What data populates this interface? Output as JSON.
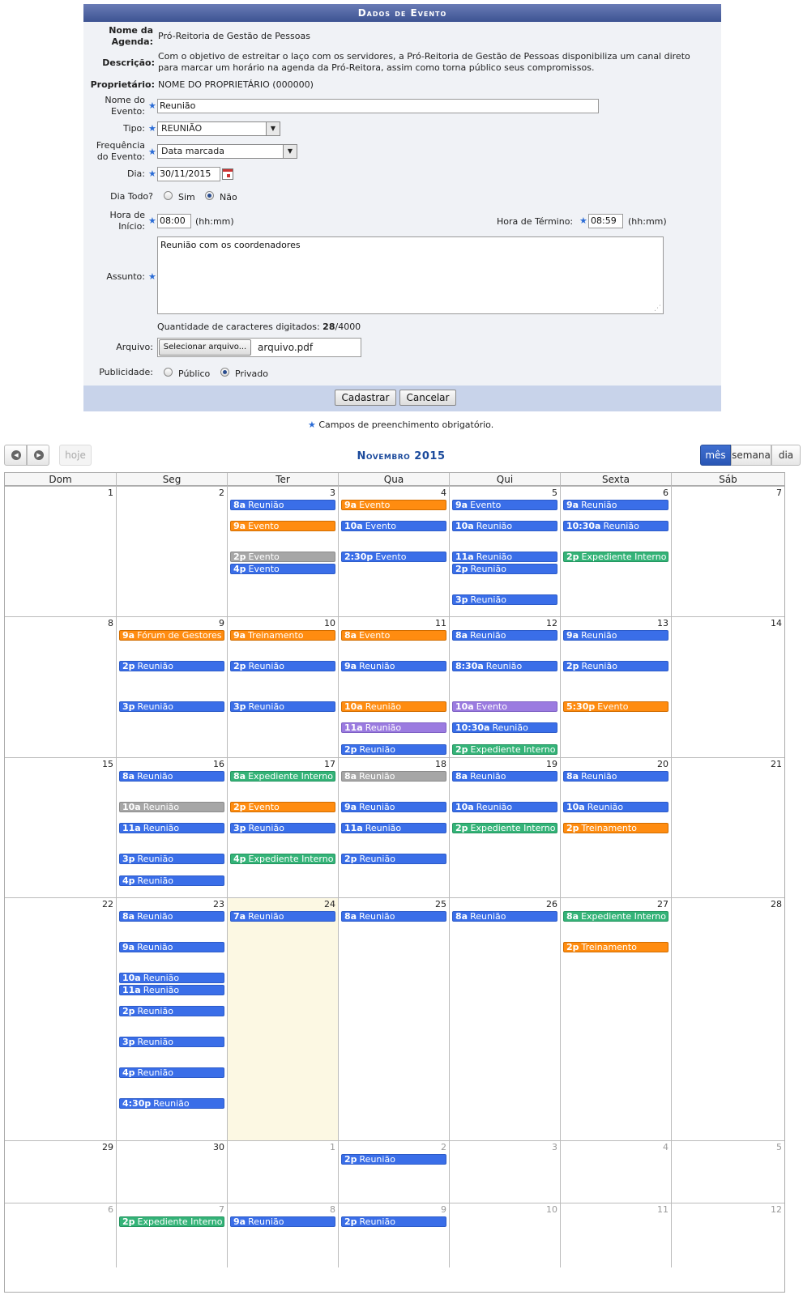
{
  "form": {
    "title": "Dados de Evento",
    "agenda_label": "Nome da Agenda:",
    "agenda_value": "Pró-Reitoria de Gestão de Pessoas",
    "descricao_label": "Descrição:",
    "descricao_line1": "Com o objetivo de estreitar o laço com os servidores, a Pró-Reitoria de Gestão de Pessoas disponibiliza um canal direto",
    "descricao_line2": "para marcar um horário na agenda da Pró-Reitora, assim como torna público seus compromissos.",
    "proprietario_label": "Proprietário:",
    "proprietario_value": "NOME DO PROPRIETÁRIO (000000)",
    "nome_evento_label1": "Nome do",
    "nome_evento_label2": "Evento:",
    "nome_evento_value": "Reunião",
    "tipo_label": "Tipo:",
    "tipo_value": "REUNIÃO",
    "frequencia_label1": "Frequência",
    "frequencia_label2": "do Evento:",
    "frequencia_value": "Data marcada",
    "dia_label": "Dia:",
    "dia_value": "30/11/2015",
    "dia_todo_label": "Dia Todo?",
    "sim_label": "Sim",
    "nao_label": "Não",
    "hora_inicio_label1": "Hora de",
    "hora_inicio_label2": "Início:",
    "hora_inicio_value": "08:00",
    "hhmm": "(hh:mm)",
    "hora_termino_label": "Hora de Término:",
    "hora_termino_value": "08:59",
    "assunto_label": "Assunto:",
    "assunto_value": "Reunião com os coordenadores",
    "chars_prefix": "Quantidade de caracteres digitados:",
    "chars_count": "28",
    "chars_max": "/4000",
    "arquivo_label": "Arquivo:",
    "arquivo_button": "Selecionar arquivo...",
    "arquivo_name": "arquivo.pdf",
    "publicidade_label": "Publicidade:",
    "publico_label": "Público",
    "privado_label": "Privado",
    "cadastrar_button": "Cadastrar",
    "cancelar_button": "Cancelar",
    "required_note": "Campos de preenchimento obrigatório.",
    "star": "★"
  },
  "calendar": {
    "title": "Novembro 2015",
    "today_button": "hoje",
    "views": [
      "mês",
      "semana",
      "dia"
    ],
    "active_view": "mês",
    "weekdays": [
      "Dom",
      "Seg",
      "Ter",
      "Qua",
      "Qui",
      "Sexta",
      "Sáb"
    ],
    "weeks": [
      [
        {
          "day": "1",
          "other": false,
          "events": []
        },
        {
          "day": "2",
          "other": false,
          "events": []
        },
        {
          "day": "3",
          "other": false,
          "events": [
            {
              "time": "8a",
              "title": "Reunião",
              "color": "blue",
              "row": 0
            },
            {
              "time": "9a",
              "title": "Evento",
              "color": "orange",
              "row": 1
            },
            {
              "time": "2p",
              "title": "Evento",
              "color": "gray",
              "row": 2
            },
            {
              "time": "4p",
              "title": "Evento",
              "color": "blue",
              "row": 3
            }
          ]
        },
        {
          "day": "4",
          "other": false,
          "events": [
            {
              "time": "9a",
              "title": "Evento",
              "color": "orange",
              "row": 0
            },
            {
              "time": "10a",
              "title": "Evento",
              "color": "blue",
              "row": 1
            },
            {
              "time": "2:30p",
              "title": "Evento",
              "color": "blue",
              "row": 2
            }
          ]
        },
        {
          "day": "5",
          "other": false,
          "events": [
            {
              "time": "9a",
              "title": "Evento",
              "color": "blue",
              "row": 0
            },
            {
              "time": "10a",
              "title": "Reunião",
              "color": "blue",
              "row": 1
            },
            {
              "time": "11a",
              "title": "Reunião",
              "color": "blue",
              "row": 2
            },
            {
              "time": "2p",
              "title": "Reunião",
              "color": "blue",
              "row": 3
            },
            {
              "time": "3p",
              "title": "Reunião",
              "color": "blue",
              "row": 4
            }
          ]
        },
        {
          "day": "6",
          "other": false,
          "events": [
            {
              "time": "9a",
              "title": "Reunião",
              "color": "blue",
              "row": 0
            },
            {
              "time": "10:30a",
              "title": "Reunião",
              "color": "blue",
              "row": 1
            },
            {
              "time": "2p",
              "title": "Expediente Interno",
              "color": "green",
              "row": 2
            }
          ]
        },
        {
          "day": "7",
          "other": false,
          "events": []
        }
      ],
      [
        {
          "day": "8",
          "other": false,
          "events": []
        },
        {
          "day": "9",
          "other": false,
          "events": [
            {
              "time": "9a",
              "title": "Fórum de Gestores",
              "color": "orange",
              "row": 0
            },
            {
              "time": "2p",
              "title": "Reunião",
              "color": "blue",
              "row": 1
            },
            {
              "time": "3p",
              "title": "Reunião",
              "color": "blue",
              "row": 2
            }
          ]
        },
        {
          "day": "10",
          "other": false,
          "events": [
            {
              "time": "9a",
              "title": "Treinamento",
              "color": "orange",
              "row": 0
            },
            {
              "time": "2p",
              "title": "Reunião",
              "color": "blue",
              "row": 1
            },
            {
              "time": "3p",
              "title": "Reunião",
              "color": "blue",
              "row": 2
            }
          ]
        },
        {
          "day": "11",
          "other": false,
          "events": [
            {
              "time": "8a",
              "title": "Evento",
              "color": "orange",
              "row": 0
            },
            {
              "time": "9a",
              "title": "Reunião",
              "color": "blue",
              "row": 1
            },
            {
              "time": "10a",
              "title": "Reunião",
              "color": "orange",
              "row": 2
            },
            {
              "time": "11a",
              "title": "Reunião",
              "color": "purple",
              "row": 3
            },
            {
              "time": "2p",
              "title": "Reunião",
              "color": "blue",
              "row": 4
            }
          ]
        },
        {
          "day": "12",
          "other": false,
          "events": [
            {
              "time": "8a",
              "title": "Reunião",
              "color": "blue",
              "row": 0
            },
            {
              "time": "8:30a",
              "title": "Reunião",
              "color": "blue",
              "row": 1
            },
            {
              "time": "10a",
              "title": "Evento",
              "color": "purple",
              "row": 2
            },
            {
              "time": "10:30a",
              "title": "Reunião",
              "color": "blue",
              "row": 3
            },
            {
              "time": "2p",
              "title": "Expediente Interno",
              "color": "green",
              "row": 4
            }
          ]
        },
        {
          "day": "13",
          "other": false,
          "events": [
            {
              "time": "9a",
              "title": "Reunião",
              "color": "blue",
              "row": 0
            },
            {
              "time": "2p",
              "title": "Reunião",
              "color": "blue",
              "row": 1
            },
            {
              "time": "5:30p",
              "title": "Evento",
              "color": "orange",
              "row": 2
            }
          ]
        },
        {
          "day": "14",
          "other": false,
          "events": []
        }
      ],
      [
        {
          "day": "15",
          "other": false,
          "events": []
        },
        {
          "day": "16",
          "other": false,
          "events": [
            {
              "time": "8a",
              "title": "Reunião",
              "color": "blue",
              "row": 0
            },
            {
              "time": "10a",
              "title": "Reunião",
              "color": "gray",
              "row": 1
            },
            {
              "time": "11a",
              "title": "Reunião",
              "color": "blue",
              "row": 2
            },
            {
              "time": "3p",
              "title": "Reunião",
              "color": "blue",
              "row": 3
            },
            {
              "time": "4p",
              "title": "Reunião",
              "color": "blue",
              "row": 4
            }
          ]
        },
        {
          "day": "17",
          "other": false,
          "events": [
            {
              "time": "8a",
              "title": "Expediente Interno",
              "color": "green",
              "row": 0
            },
            {
              "time": "2p",
              "title": "Evento",
              "color": "orange",
              "row": 1
            },
            {
              "time": "3p",
              "title": "Reunião",
              "color": "blue",
              "row": 2
            },
            {
              "time": "4p",
              "title": "Expediente Interno",
              "color": "green",
              "row": 3
            }
          ]
        },
        {
          "day": "18",
          "other": false,
          "events": [
            {
              "time": "8a",
              "title": "Reunião",
              "color": "gray",
              "row": 0
            },
            {
              "time": "9a",
              "title": "Reunião",
              "color": "blue",
              "row": 1
            },
            {
              "time": "11a",
              "title": "Reunião",
              "color": "blue",
              "row": 2
            },
            {
              "time": "2p",
              "title": "Reunião",
              "color": "blue",
              "row": 3
            }
          ]
        },
        {
          "day": "19",
          "other": false,
          "events": [
            {
              "time": "8a",
              "title": "Reunião",
              "color": "blue",
              "row": 0
            },
            {
              "time": "10a",
              "title": "Reunião",
              "color": "blue",
              "row": 1
            },
            {
              "time": "2p",
              "title": "Expediente Interno",
              "color": "green",
              "row": 2
            }
          ]
        },
        {
          "day": "20",
          "other": false,
          "events": [
            {
              "time": "8a",
              "title": "Reunião",
              "color": "blue",
              "row": 0
            },
            {
              "time": "10a",
              "title": "Reunião",
              "color": "blue",
              "row": 1
            },
            {
              "time": "2p",
              "title": "Treinamento",
              "color": "orange",
              "row": 2
            }
          ]
        },
        {
          "day": "21",
          "other": false,
          "events": []
        }
      ],
      [
        {
          "day": "22",
          "other": false,
          "events": []
        },
        {
          "day": "23",
          "other": false,
          "events": [
            {
              "time": "8a",
              "title": "Reunião",
              "color": "blue",
              "row": 0
            },
            {
              "time": "9a",
              "title": "Reunião",
              "color": "blue",
              "row": 1
            },
            {
              "time": "10a",
              "title": "Reunião",
              "color": "blue",
              "row": 2
            },
            {
              "time": "11a",
              "title": "Reunião",
              "color": "blue",
              "row": 3
            },
            {
              "time": "2p",
              "title": "Reunião",
              "color": "blue",
              "row": 4
            },
            {
              "time": "3p",
              "title": "Reunião",
              "color": "blue",
              "row": 5
            },
            {
              "time": "4p",
              "title": "Reunião",
              "color": "blue",
              "row": 6
            },
            {
              "time": "4:30p",
              "title": "Reunião",
              "color": "blue",
              "row": 7
            }
          ]
        },
        {
          "day": "24",
          "other": false,
          "today": true,
          "events": [
            {
              "time": "7a",
              "title": "Reunião",
              "color": "blue",
              "row": 0
            }
          ]
        },
        {
          "day": "25",
          "other": false,
          "events": [
            {
              "time": "8a",
              "title": "Reunião",
              "color": "blue",
              "row": 0
            }
          ]
        },
        {
          "day": "26",
          "other": false,
          "events": [
            {
              "time": "8a",
              "title": "Reunião",
              "color": "blue",
              "row": 0
            }
          ]
        },
        {
          "day": "27",
          "other": false,
          "events": [
            {
              "time": "8a",
              "title": "Expediente Interno",
              "color": "green",
              "row": 0
            },
            {
              "time": "2p",
              "title": "Treinamento",
              "color": "orange",
              "row": 1
            }
          ]
        },
        {
          "day": "28",
          "other": false,
          "events": []
        }
      ],
      [
        {
          "day": "29",
          "other": false,
          "events": []
        },
        {
          "day": "30",
          "other": false,
          "events": []
        },
        {
          "day": "1",
          "other": true,
          "events": []
        },
        {
          "day": "2",
          "other": true,
          "events": [
            {
              "time": "2p",
              "title": "Reunião",
              "color": "blue",
              "row": 0
            }
          ]
        },
        {
          "day": "3",
          "other": true,
          "events": []
        },
        {
          "day": "4",
          "other": true,
          "events": []
        },
        {
          "day": "5",
          "other": true,
          "events": []
        }
      ],
      [
        {
          "day": "6",
          "other": true,
          "events": []
        },
        {
          "day": "7",
          "other": true,
          "events": [
            {
              "time": "2p",
              "title": "Expediente Interno",
              "color": "green",
              "row": 0
            }
          ]
        },
        {
          "day": "8",
          "other": true,
          "events": [
            {
              "time": "9a",
              "title": "Reunião",
              "color": "blue",
              "row": 0
            }
          ]
        },
        {
          "day": "9",
          "other": true,
          "events": [
            {
              "time": "2p",
              "title": "Reunião",
              "color": "blue",
              "row": 0
            }
          ]
        },
        {
          "day": "10",
          "other": true,
          "events": []
        },
        {
          "day": "11",
          "other": true,
          "events": []
        },
        {
          "day": "12",
          "other": true,
          "events": []
        }
      ]
    ]
  }
}
